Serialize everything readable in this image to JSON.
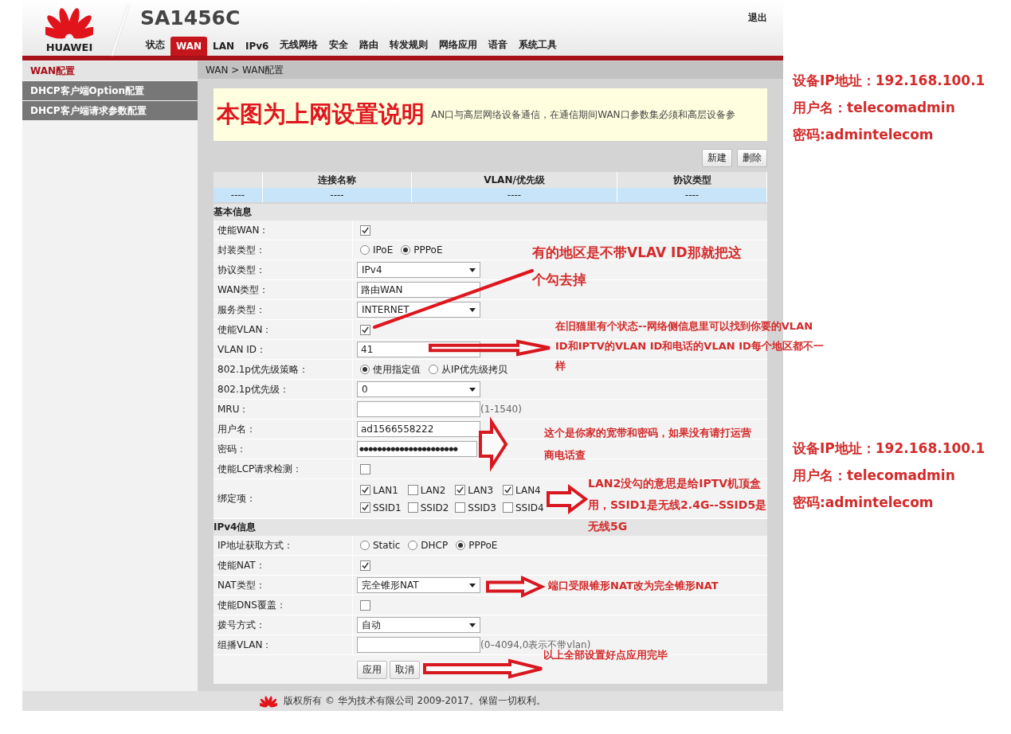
{
  "header": {
    "logo_text": "HUAWEI",
    "model": "SA1456C",
    "logout": "退出",
    "tabs": [
      {
        "label": "状态",
        "selected": false
      },
      {
        "label": "WAN",
        "selected": true
      },
      {
        "label": "LAN",
        "selected": false
      },
      {
        "label": "IPv6",
        "selected": false
      },
      {
        "label": "无线网络",
        "selected": false
      },
      {
        "label": "安全",
        "selected": false
      },
      {
        "label": "路由",
        "selected": false
      },
      {
        "label": "转发规则",
        "selected": false
      },
      {
        "label": "网络应用",
        "selected": false
      },
      {
        "label": "语音",
        "selected": false
      },
      {
        "label": "系统工具",
        "selected": false
      }
    ]
  },
  "sidebar": {
    "items": [
      {
        "label": "WAN配置",
        "selected": true
      },
      {
        "label": "DHCP客户端Option配置",
        "selected": false
      },
      {
        "label": "DHCP客户端请求参数配置",
        "selected": false
      }
    ]
  },
  "breadcrumb": "WAN > WAN配置",
  "notice": {
    "overlay_title": "本图为上网设置说明",
    "text": "AN口与高层网络设备通信，在通信期间WAN口参数集必须和高层设备参"
  },
  "toolbar_buttons": [
    "新建",
    "删除"
  ],
  "table": {
    "columns": [
      "",
      "连接名称",
      "VLAN/优先级",
      "协议类型"
    ],
    "rows": [
      [
        "----",
        "----",
        "----",
        "----"
      ]
    ]
  },
  "sections": [
    {
      "title": "基本信息",
      "rows": [
        {
          "label": "使能WAN：",
          "kind": "checkbox",
          "checked": true
        },
        {
          "label": "封装类型：",
          "kind": "radio",
          "options": [
            {
              "label": "IPoE",
              "selected": false
            },
            {
              "label": "PPPoE",
              "selected": true
            }
          ]
        },
        {
          "label": "协议类型：",
          "kind": "select",
          "value": "IPv4"
        },
        {
          "label": "WAN类型：",
          "kind": "text",
          "value": "路由WAN"
        },
        {
          "label": "服务类型：",
          "kind": "select",
          "value": "INTERNET"
        },
        {
          "label": "使能VLAN：",
          "kind": "checkbox",
          "checked": true
        },
        {
          "label": "VLAN ID：",
          "kind": "text",
          "value": "41"
        },
        {
          "label": "802.1p优先级策略：",
          "kind": "radio",
          "options": [
            {
              "label": "使用指定值",
              "selected": true
            },
            {
              "label": "从IP优先级拷贝",
              "selected": false
            }
          ]
        },
        {
          "label": "802.1p优先级：",
          "kind": "select",
          "value": "0"
        },
        {
          "label": "MRU：",
          "kind": "text",
          "hint": "(1-1540)"
        },
        {
          "label": "用户名：",
          "kind": "text",
          "value": "ad1566558222"
        },
        {
          "label": "密码：",
          "kind": "text",
          "value": "●●●●●●●●●●●●●●●●●●●●●●"
        },
        {
          "label": "使能LCP请求检测：",
          "kind": "checkbox",
          "checked": false
        },
        {
          "label": "绑定项：",
          "kind": "checkgroup",
          "options": [
            {
              "label": "LAN1",
              "checked": true
            },
            {
              "label": "LAN2",
              "checked": false
            },
            {
              "label": "LAN3",
              "checked": true
            },
            {
              "label": "LAN4",
              "checked": true
            },
            {
              "label": "SSID1",
              "checked": true
            },
            {
              "label": "SSID2",
              "checked": false
            },
            {
              "label": "SSID3",
              "checked": false
            },
            {
              "label": "SSID4",
              "checked": false
            }
          ]
        }
      ]
    },
    {
      "title": "IPv4信息",
      "rows": [
        {
          "label": "IP地址获取方式：",
          "kind": "radio",
          "options": [
            {
              "label": "Static",
              "selected": false
            },
            {
              "label": "DHCP",
              "selected": false
            },
            {
              "label": "PPPoE",
              "selected": true
            }
          ]
        },
        {
          "label": "使能NAT：",
          "kind": "checkbox",
          "checked": true
        },
        {
          "label": "NAT类型：",
          "kind": "select",
          "value": "完全锥形NAT"
        },
        {
          "label": "使能DNS覆盖：",
          "kind": "checkbox",
          "checked": false
        },
        {
          "label": "拨号方式：",
          "kind": "select",
          "value": "自动"
        },
        {
          "label": "组播VLAN：",
          "kind": "text",
          "hint": "(0–4094,0表示不带vlan)"
        }
      ]
    }
  ],
  "form_buttons": [
    "应用",
    "取消"
  ],
  "annotations": [
    {
      "text": "有的地区是不带VLAV ID那就把这个勾去掉"
    },
    {
      "text": "在旧猫里有个状态--网络侧信息里可以找到你要的VLAN ID和IPTV的VLAN ID和电话的VLAN ID每个地区都不一样"
    },
    {
      "text": "这个是你家的宽带和密码，如果没有请打运营商电话查"
    },
    {
      "text": "LAN2没勾的意思是给IPTV机顶盒用，SSID1是无线2.4G--SSID5是无线5G"
    },
    {
      "text": "端口受限锥形NAT改为完全锥形NAT"
    },
    {
      "text": "以上全部设置好点应用完毕"
    }
  ],
  "credentials": [
    {
      "lines": [
        "设备IP地址：192.168.100.1",
        "用户名：telecomadmin",
        "密码:admintelecom"
      ]
    },
    {
      "lines": [
        "设备IP地址：192.168.100.1",
        "用户名：telecomadmin",
        "密码:admintelecom"
      ]
    }
  ],
  "footer": "版权所有 © 华为技术有限公司 2009-2017。保留一切权利。"
}
